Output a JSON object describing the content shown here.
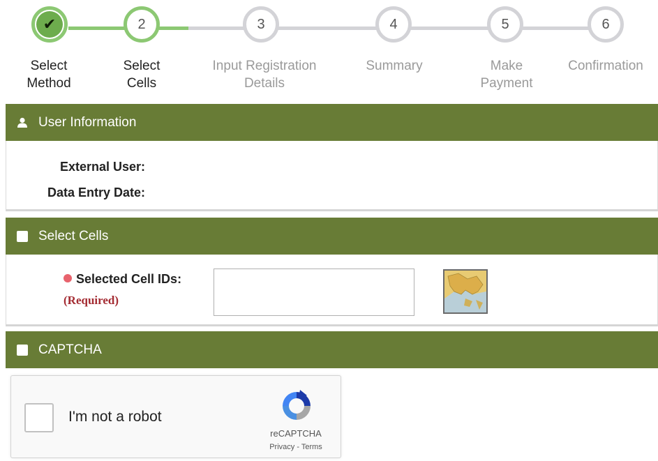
{
  "stepper": {
    "steps": [
      {
        "number": "",
        "label": "Select\nMethod",
        "state": "done",
        "icon": "check-icon"
      },
      {
        "number": "2",
        "label": "Select\nCells",
        "state": "active"
      },
      {
        "number": "3",
        "label": "Input Registration\nDetails",
        "state": "todo"
      },
      {
        "number": "4",
        "label": "Summary",
        "state": "todo"
      },
      {
        "number": "5",
        "label": "Make\nPayment",
        "state": "todo"
      },
      {
        "number": "6",
        "label": "Confirmation",
        "state": "todo"
      }
    ],
    "check_glyph": "✔"
  },
  "user_info": {
    "title": "User Information",
    "icon": "user-icon",
    "external_user_label": "External User:",
    "data_entry_date_label": "Data Entry Date:"
  },
  "select_cells": {
    "title": "Select Cells",
    "icon": "square-icon",
    "selected_cells_label": "Selected Cell IDs:",
    "required_text": "(Required)",
    "selected_cells_value": "",
    "map_button_icon": "map-icon"
  },
  "captcha": {
    "title": "CAPTCHA",
    "icon": "square-icon",
    "checkbox_label": "I'm not a robot",
    "brand": "reCAPTCHA",
    "links": "Privacy - Terms"
  },
  "colors": {
    "header_green": "#687c36",
    "step_done_green": "#8cc873",
    "step_todo_grey": "#d3d3d7",
    "required_red": "#a42c33",
    "required_dot": "#e8636d"
  }
}
